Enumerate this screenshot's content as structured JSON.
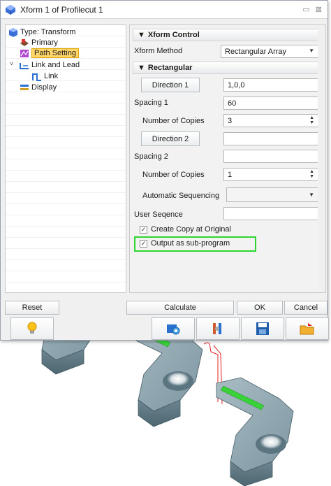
{
  "window": {
    "title": "Xform 1 of Profilecut 1",
    "title_buttons": [
      "▭",
      "⊠"
    ]
  },
  "tree": {
    "items": [
      {
        "label": "Type: Transform",
        "icon": "cube-icon"
      },
      {
        "label": "Primary",
        "icon": "primary-icon"
      },
      {
        "label": "Path Setting",
        "icon": "path-setting-icon",
        "selected": true
      },
      {
        "label": "Link and Lead",
        "icon": "link-lead-icon"
      },
      {
        "label": "Link",
        "icon": "link-icon"
      },
      {
        "label": "Display",
        "icon": "display-icon"
      }
    ]
  },
  "xform_control": {
    "header": "Xform Control",
    "method_label": "Xform Method",
    "method_value": "Rectangular Array"
  },
  "rectangular": {
    "header": "Rectangular",
    "direction1_label": "Direction 1",
    "direction1_value": "1,0,0",
    "spacing1_label": "Spacing 1",
    "spacing1_value": "60",
    "copies1_label": "Number of Copies",
    "copies1_value": "3",
    "direction2_label": "Direction 2",
    "direction2_value": "",
    "spacing2_label": "Spacing 2",
    "spacing2_value": "",
    "copies2_label": "Number of Copies",
    "copies2_value": "1",
    "auto_seq_label": "Automatic Sequencing",
    "auto_seq_value": "",
    "user_seq_label": "User Seqence",
    "user_seq_value": "",
    "copy_original_label": "Create Copy at Original",
    "copy_original_checked": true,
    "sub_program_label": "Output as sub-program",
    "sub_program_checked": true
  },
  "buttons": {
    "reset": "Reset",
    "calculate": "Calculate",
    "ok": "OK",
    "cancel": "Cancel"
  },
  "toolbar_icons": [
    "lightbulb-icon",
    "settings-icon",
    "tools-icon",
    "save-icon",
    "open-folder-icon"
  ],
  "colors": {
    "selection": "#ffd66b",
    "highlight": "#2ed52e",
    "part_body": "#7f9aa6",
    "toolpath_green": "#39d339",
    "link_red": "#e02020"
  }
}
